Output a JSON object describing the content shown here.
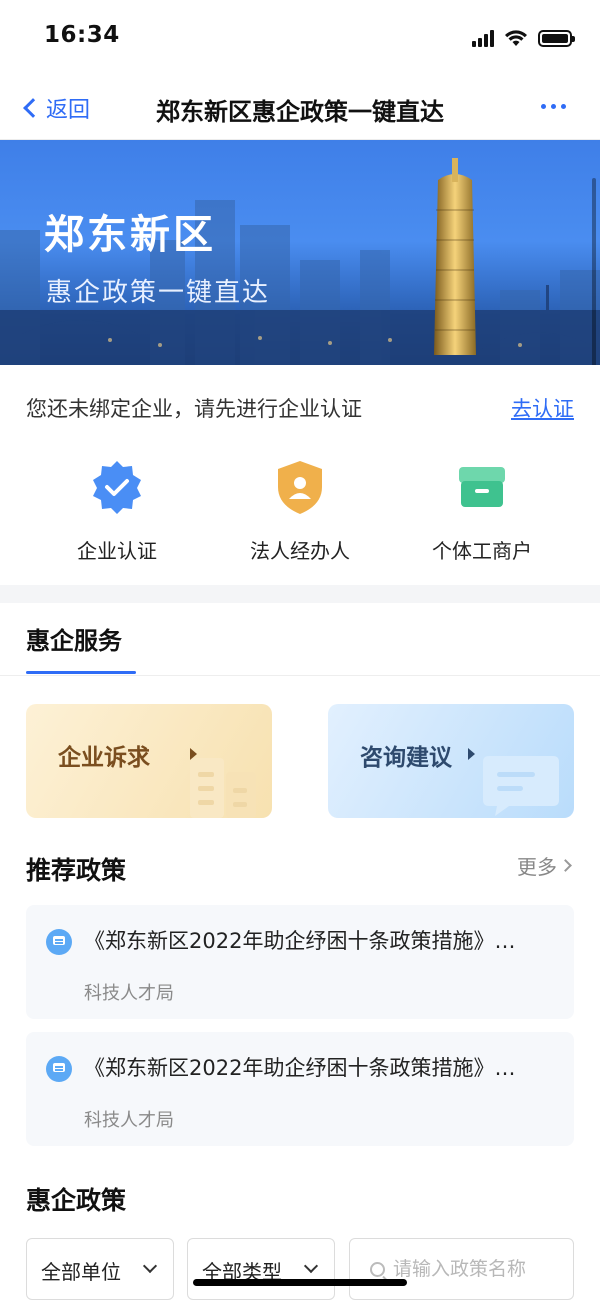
{
  "status_bar": {
    "time": "16:34"
  },
  "nav": {
    "back_label": "返回",
    "title": "郑东新区惠企政策一键直达"
  },
  "banner": {
    "title": "郑东新区",
    "subtitle": "惠企政策一键直达"
  },
  "certification": {
    "tip": "您还未绑定企业，请先进行企业认证",
    "link_label": "去认证",
    "items": [
      {
        "label": "企业认证",
        "icon": "verified-badge-icon",
        "color": "#4a8ef5"
      },
      {
        "label": "法人经办人",
        "icon": "person-shield-icon",
        "color": "#f0b04b"
      },
      {
        "label": "个体工商户",
        "icon": "storefront-icon",
        "color": "#3fc28f"
      }
    ]
  },
  "services": {
    "tab_label": "惠企服务",
    "cards": [
      {
        "label": "企业诉求",
        "icon": "buildings-icon"
      },
      {
        "label": "咨询建议",
        "icon": "message-icon"
      }
    ]
  },
  "recommended": {
    "title": "推荐政策",
    "more_label": "更多",
    "items": [
      {
        "title": "《郑东新区2022年助企纾困十条政策措施》…",
        "department": "科技人才局"
      },
      {
        "title": "《郑东新区2022年助企纾困十条政策措施》…",
        "department": "科技人才局"
      }
    ]
  },
  "policies": {
    "title": "惠企政策",
    "filters": {
      "unit_label": "全部单位",
      "type_label": "全部类型"
    },
    "search": {
      "placeholder": "请输入政策名称",
      "value": ""
    }
  },
  "colors": {
    "accent": "#2f6cf6"
  }
}
